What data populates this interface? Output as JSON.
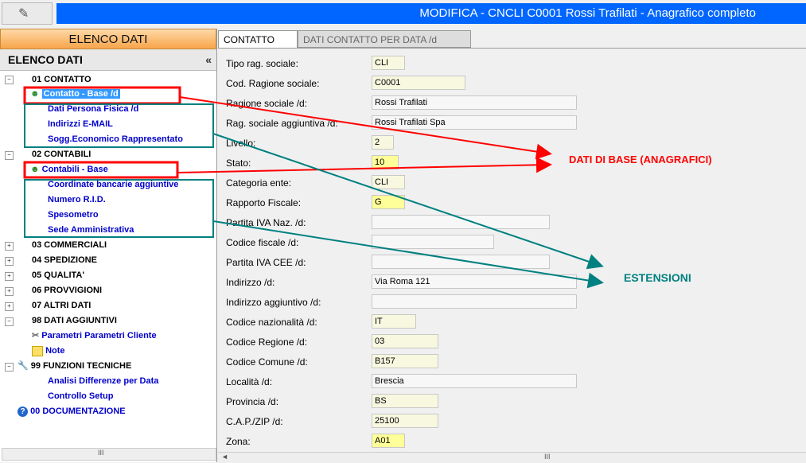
{
  "window": {
    "title": "MODIFICA - CNCLI C0001 Rossi Trafilati - Anagrafico completo"
  },
  "left_panel": {
    "header": "ELENCO DATI",
    "tree_title": "ELENCO DATI",
    "collapse_glyph": "«",
    "scroll_glyph": "III"
  },
  "tree": {
    "contatto": "01 CONTATTO",
    "contatto_base": "Contatto - Base /d",
    "dati_persona": "Dati Persona Fisica /d",
    "indirizzi_email": "Indirizzi E-MAIL",
    "sogg_economico": "Sogg.Economico Rappresentato",
    "contabili": "02 CONTABILI",
    "contabili_base": "Contabili - Base",
    "coordinate": "Coordinate bancarie aggiuntive",
    "numero_rid": "Numero R.I.D.",
    "spesometro": "Spesometro",
    "sede_amm": "Sede Amministrativa",
    "commerciali": "03 COMMERCIALI",
    "spedizione": "04 SPEDIZIONE",
    "qualita": "05 QUALITA'",
    "provvigioni": "06 PROVVIGIONI",
    "altri_dati": "07 ALTRI DATI",
    "dati_aggiuntivi": "98 DATI AGGIUNTIVI",
    "parametri": "Parametri Parametri Cliente",
    "note": "Note",
    "funzioni": "99 FUNZIONI TECNICHE",
    "analisi": "Analisi Differenze per Data",
    "controllo": "Controllo Setup",
    "documentazione": "00 DOCUMENTAZIONE"
  },
  "tabs": {
    "contatto": "CONTATTO",
    "per_data": "DATI CONTATTO PER DATA /d"
  },
  "form": [
    {
      "label": "Tipo rag. sociale:",
      "value": "CLI"
    },
    {
      "label": "Cod. Ragione sociale:",
      "value": "C0001"
    },
    {
      "label": "Ragione sociale /d:",
      "value": "Rossi Trafilati"
    },
    {
      "label": "Rag. sociale aggiuntiva /d:",
      "value": "Rossi Trafilati Spa"
    },
    {
      "label": "Livello:",
      "value": "2"
    },
    {
      "label": "Stato:",
      "value": "10"
    },
    {
      "label": "Categoria ente:",
      "value": "CLI"
    },
    {
      "label": "Rapporto Fiscale:",
      "value": "G"
    },
    {
      "label": "Partita IVA Naz. /d:",
      "value": ""
    },
    {
      "label": "Codice fiscale /d:",
      "value": ""
    },
    {
      "label": "Partita IVA CEE /d:",
      "value": ""
    },
    {
      "label": "Indirizzo /d:",
      "value": "Via Roma 121"
    },
    {
      "label": "Indirizzo aggiuntivo /d:",
      "value": ""
    },
    {
      "label": "Codice nazionalità /d:",
      "value": "IT"
    },
    {
      "label": "Codice Regione /d:",
      "value": "03"
    },
    {
      "label": "Codice Comune /d:",
      "value": "B157"
    },
    {
      "label": "Località /d:",
      "value": "Brescia"
    },
    {
      "label": "Provincia /d:",
      "value": "BS"
    },
    {
      "label": "C.A.P./ZIP /d:",
      "value": "25100"
    },
    {
      "label": "Zona:",
      "value": "A01"
    }
  ],
  "annotations": {
    "dati_base": "DATI DI BASE (ANAGRAFICI)",
    "estensioni": "ESTENSIONI",
    "red_color": "#ff0000",
    "teal_color": "#008080"
  },
  "bottom_scroll": {
    "left_arrow": "◄",
    "thumb": "III"
  }
}
